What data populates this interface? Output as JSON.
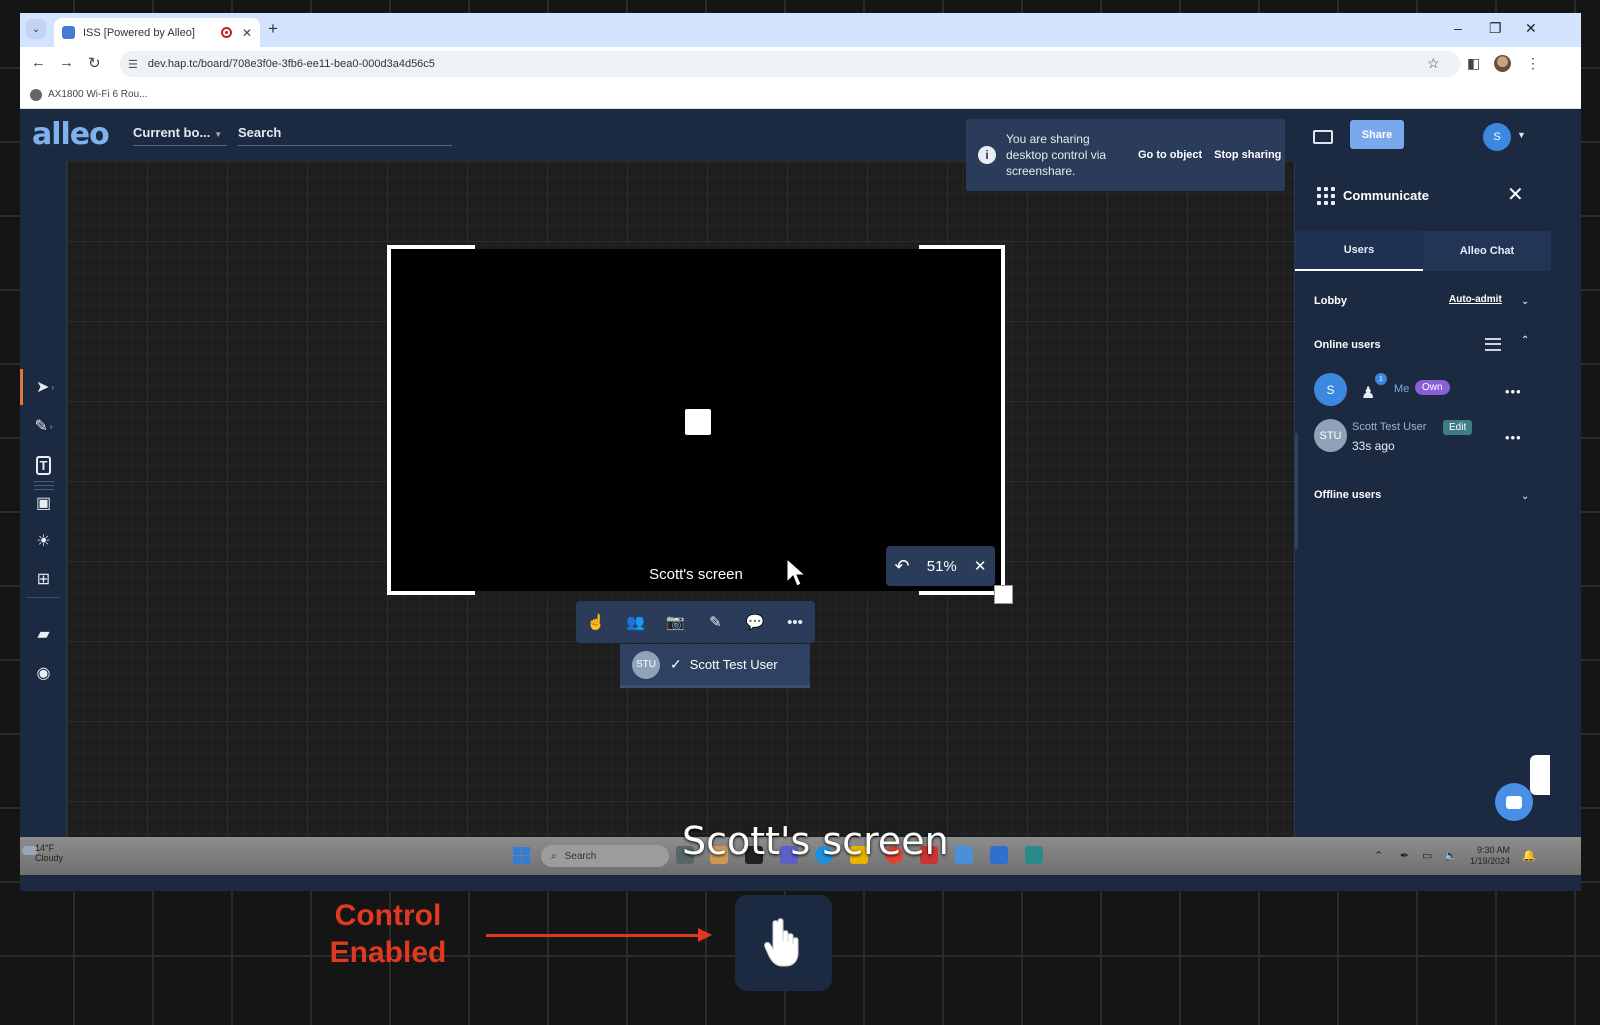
{
  "browser": {
    "tab_title": "ISS [Powered by Alleo]",
    "url": "dev.hap.tc/board/708e3f0e-3fb6-ee11-bea0-000d3a4d56c5",
    "bookmark": "AX1800 Wi-Fi 6 Rou...",
    "icons": [
      "back-icon",
      "forward-icon",
      "reload-icon",
      "star-icon",
      "sidepanel-icon",
      "profile-avatar",
      "kebab-menu-icon"
    ]
  },
  "header": {
    "logo": "alleo",
    "board_selector": "Current bo...",
    "search_placeholder": "Search",
    "share_label": "Share",
    "avatar_initial": "S"
  },
  "share_toast": {
    "message": "You are sharing desktop control via screenshare.",
    "go_to_object": "Go to object",
    "stop_sharing": "Stop sharing"
  },
  "left_toolbar": {
    "tools": [
      "select",
      "pen",
      "text",
      "sticky",
      "idea",
      "widgets",
      "files",
      "navigate"
    ]
  },
  "screenshare": {
    "caption": "Scott's screen",
    "zoom": "51%"
  },
  "control_menu": {
    "user_initials": "STU",
    "user_name": "Scott Test User"
  },
  "right_panel": {
    "title": "Communicate",
    "tabs": [
      "Users",
      "Alleo Chat"
    ],
    "active_tab": "Users",
    "lobby_label": "Lobby",
    "auto_admit": "Auto-admit",
    "online_label": "Online users",
    "offline_label": "Offline users",
    "users": [
      {
        "initials": "S",
        "label": "Me",
        "role": "Own",
        "badge": "1"
      },
      {
        "initials": "STU",
        "label": "Scott Test User",
        "role": "Edit",
        "status": "33s ago"
      }
    ]
  },
  "taskbar": {
    "temp": "14°F",
    "weather": "Cloudy",
    "search": "Search",
    "time": "9:30 AM",
    "date": "1/19/2024"
  },
  "overlay": {
    "big_caption": "Scott's screen",
    "annotation": "Control Enabled"
  },
  "colors": {
    "app_navy": "#1b2a41",
    "accent_blue": "#7aa8ec",
    "own_badge": "#8a5ed6",
    "edit_badge": "#3e7d84",
    "annotation_red": "#e0391f"
  }
}
